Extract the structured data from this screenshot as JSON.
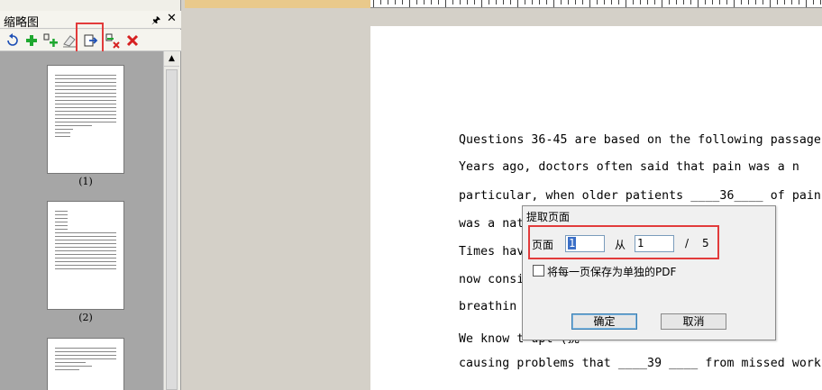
{
  "panel": {
    "title": "缩略图",
    "pin_icon": "pin-icon",
    "close_icon": "close-icon",
    "toolbar": [
      {
        "name": "rotate-icon"
      },
      {
        "name": "add-page-icon"
      },
      {
        "name": "insert-page-icon"
      },
      {
        "name": "eraser-icon"
      },
      {
        "name": "extract-page-icon"
      },
      {
        "name": "delete-selected-icon"
      },
      {
        "name": "delete-icon"
      }
    ],
    "thumbnails": [
      {
        "label": "(1)"
      },
      {
        "label": "(2)"
      },
      {
        "label": ""
      }
    ]
  },
  "document": {
    "lines": [
      "Questions 36-45 are based on the following passage.",
      "Years ago, doctors often said that pain was a n",
      "particular, when older patients ____36____ of pain,",
      "was a nat                                     have to",
      "Times hav                                   37____.",
      "now consi                                     as blo",
      " breathin                                   son’s",
      "We know t                                   upt (扰",
      "causing problems that ____39 ____ from missed work"
    ]
  },
  "dialog": {
    "title": "提取页面",
    "page_label": "页面",
    "from_value": "1",
    "from_label": "从",
    "to_value": "1",
    "separator": "/",
    "total": "5",
    "checkbox_label": "将每一页保存为单独的PDF",
    "ok_label": "确定",
    "cancel_label": "取消"
  }
}
